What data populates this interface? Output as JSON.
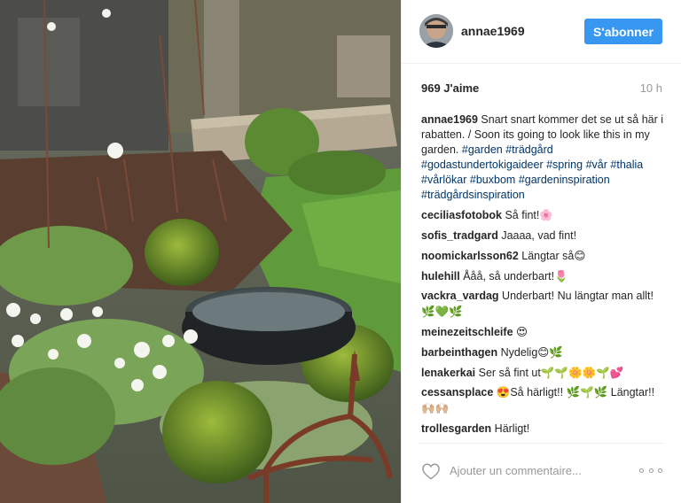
{
  "post": {
    "username": "annae1969",
    "follow_label": "S'abonner",
    "likes": "969 J'aime",
    "time": "10 h",
    "caption": {
      "author": "annae1969",
      "text": " Snart snart kommer det se ut så här i rabatten. / Soon its going to look like this in my garden. ",
      "hashtags": [
        "#garden",
        "#trädgård",
        "#godastundertokigaideer",
        "#spring",
        "#vår",
        "#thalia",
        "#vårlökar",
        "#buxbom",
        "#gardeninspiration",
        "#trädgårdsinspiration"
      ]
    },
    "comments": [
      {
        "author": "ceciliasfotobok",
        "text": " Så fint!",
        "emoji": "🌸"
      },
      {
        "author": "sofis_tradgard",
        "text": " Jaaaa, vad fint!",
        "emoji": ""
      },
      {
        "author": "noomickarlsson62",
        "text": " Längtar så",
        "emoji": "😊"
      },
      {
        "author": "hulehill",
        "text": " Ååå, så underbart!",
        "emoji": "🌷"
      },
      {
        "author": "vackra_vardag",
        "text": " Underbart! Nu längtar man allt!",
        "emoji": "🌿💚🌿"
      },
      {
        "author": "meinezeitschleife",
        "text": " ",
        "emoji": "😍"
      },
      {
        "author": "barbeinthagen",
        "text": " Nydelig",
        "emoji": "😊🌿"
      },
      {
        "author": "lenakerkai",
        "text": " Ser så fint ut",
        "emoji": "🌱🌱🌼🌼🌱💕"
      },
      {
        "author": "cessansplace",
        "text": " 😍Så härligt!! 🌿🌱🌿 Längtar!! ",
        "emoji": "🙌🏼🙌🏼"
      },
      {
        "author": "trollesgarden",
        "text": " Härligt!",
        "emoji": ""
      }
    ],
    "comment_placeholder": "Ajouter un commentaire...",
    "icons": {
      "like": "heart-icon",
      "more": "more-options-icon"
    }
  },
  "colors": {
    "accent": "#3897f0",
    "hashtag": "#003569",
    "muted": "#999999"
  }
}
